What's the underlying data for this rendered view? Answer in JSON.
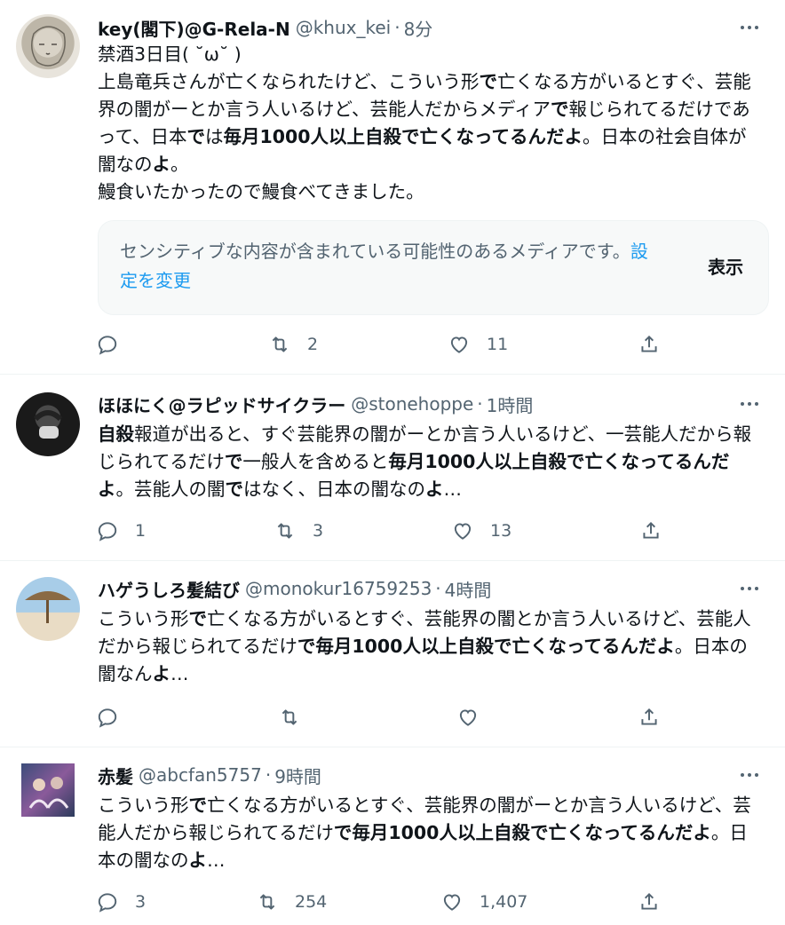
{
  "tweets": [
    {
      "name": "key(閣下)@G-Rela-N",
      "handle": "@khux_kei",
      "time": "8分",
      "text_parts": [
        {
          "t": "禁酒3日目( ˘ω˘ )\n上島竜兵さんが亡くなられたけど、こういう形",
          "b": false
        },
        {
          "t": "で",
          "b": true
        },
        {
          "t": "亡くなる方がいるとすぐ、芸能界の闇がーとか言う人いるけど、芸能人だからメディア",
          "b": false
        },
        {
          "t": "で",
          "b": true
        },
        {
          "t": "報じられてるだけであって、日本",
          "b": false
        },
        {
          "t": "で",
          "b": true
        },
        {
          "t": "は",
          "b": false
        },
        {
          "t": "毎月1000人以上自殺で亡くなってるんだよ",
          "b": true
        },
        {
          "t": "。日本の社会自体が闇なの",
          "b": false
        },
        {
          "t": "よ",
          "b": true
        },
        {
          "t": "。\n鰻食いたかったので鰻食べてきました。",
          "b": false
        }
      ],
      "sensitive": {
        "message": "センシティブな内容が含まれている可能性のあるメディアです。",
        "link": "設定を変更",
        "show": "表示"
      },
      "reply": "",
      "retweet": "2",
      "like": "11"
    },
    {
      "name": "ほほにく@ラピッドサイクラー",
      "handle": "@stonehoppe",
      "time": "1時間",
      "text_parts": [
        {
          "t": "自殺",
          "b": true
        },
        {
          "t": "報道が出ると、すぐ芸能界の闇がーとか言う人いるけど、一芸能人だから報じられてるだけ",
          "b": false
        },
        {
          "t": "で",
          "b": true
        },
        {
          "t": "一般人を含めると",
          "b": false
        },
        {
          "t": "毎月1000人以上自殺で亡くなってるんだよ",
          "b": true
        },
        {
          "t": "。芸能人の闇",
          "b": false
        },
        {
          "t": "で",
          "b": true
        },
        {
          "t": "はなく、日本の闇なの",
          "b": false
        },
        {
          "t": "よ",
          "b": true
        },
        {
          "t": "…",
          "b": false
        }
      ],
      "reply": "1",
      "retweet": "3",
      "like": "13"
    },
    {
      "name": "ハゲうしろ髪結び",
      "handle": "@monokur16759253",
      "time": "4時間",
      "text_parts": [
        {
          "t": "こういう形",
          "b": false
        },
        {
          "t": "で",
          "b": true
        },
        {
          "t": "亡くなる方がいるとすぐ、芸能界の闇とか言う人いるけど、芸能人だから報じられてるだけ",
          "b": false
        },
        {
          "t": "で毎月1000人以上自殺で亡くなってるんだよ",
          "b": true
        },
        {
          "t": "。日本の闇なん",
          "b": false
        },
        {
          "t": "よ",
          "b": true
        },
        {
          "t": "…",
          "b": false
        }
      ],
      "reply": "",
      "retweet": "",
      "like": ""
    },
    {
      "name": "赤髪",
      "handle": "@abcfan5757",
      "time": "9時間",
      "text_parts": [
        {
          "t": "こういう形",
          "b": false
        },
        {
          "t": "で",
          "b": true
        },
        {
          "t": "亡くなる方がいるとすぐ、芸能界の闇がーとか言う人いるけど、芸能人だから報じられてるだけ",
          "b": false
        },
        {
          "t": "で毎月1000人以上自殺で亡くなってるんだよ",
          "b": true
        },
        {
          "t": "。日本の闇なの",
          "b": false
        },
        {
          "t": "よ",
          "b": true
        },
        {
          "t": "…",
          "b": false
        }
      ],
      "reply": "3",
      "retweet": "254",
      "like": "1,407"
    }
  ],
  "icons": [
    "reply-icon",
    "retweet-icon",
    "like-icon",
    "share-icon",
    "more-icon"
  ],
  "colors": {
    "secondary": "#536471",
    "link": "#1d9bf0",
    "divider": "#eff3f4"
  }
}
